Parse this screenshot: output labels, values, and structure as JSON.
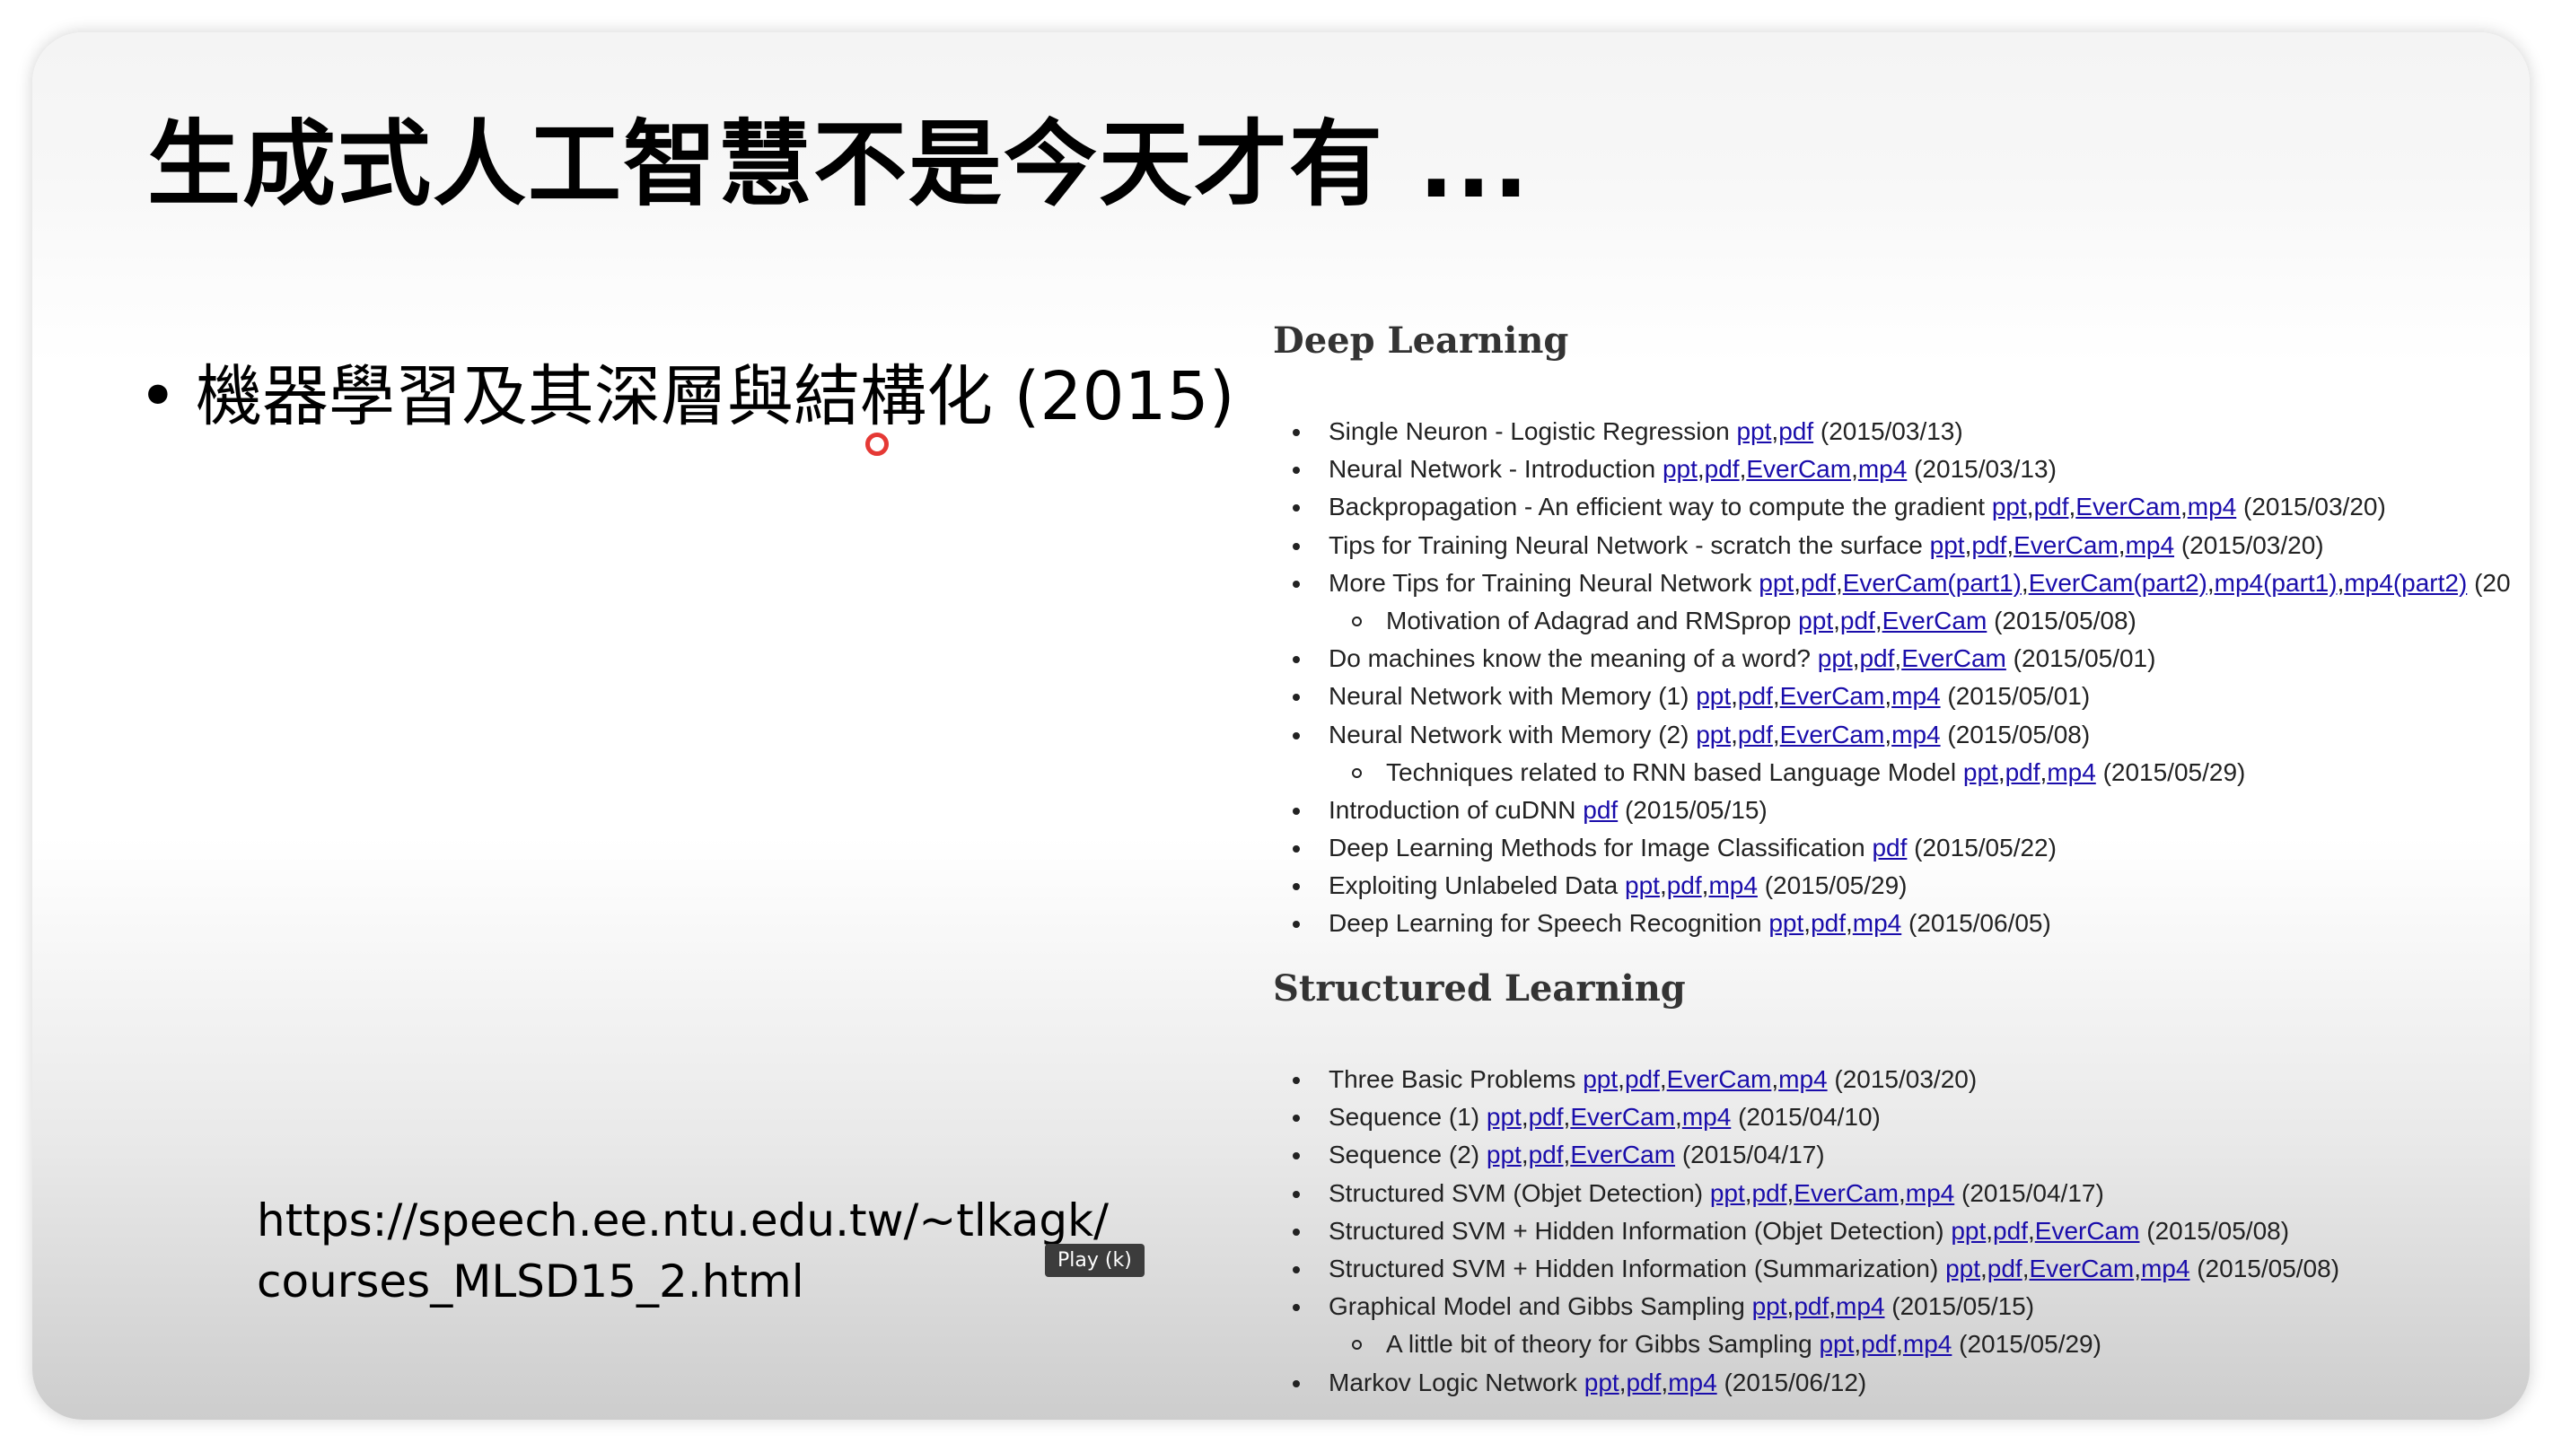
{
  "slide": {
    "title": "生成式人工智慧不是今天才有 ...",
    "bullet": "機器學習及其深層與結構化 (2015)",
    "url_line1": "https://speech.ee.ntu.edu.tw/~tlkagk/",
    "url_line2": "courses_MLSD15_2.html"
  },
  "player": {
    "tooltip": "Play (k)"
  },
  "cursor": {
    "icon": "pointer-cursor-icon",
    "color": "#e53935"
  },
  "deep_learning": {
    "heading": "Deep Learning",
    "items": [
      {
        "level": "top",
        "text": "Single Neuron - Logistic Regression",
        "links": [
          "ppt",
          "pdf"
        ],
        "date": "(2015/03/13)"
      },
      {
        "level": "top",
        "text": "Neural Network - Introduction",
        "links": [
          "ppt",
          "pdf",
          "EverCam",
          "mp4"
        ],
        "date": "(2015/03/13)"
      },
      {
        "level": "top",
        "text": "Backpropagation - An efficient way to compute the gradient",
        "links": [
          "ppt",
          "pdf",
          "EverCam",
          "mp4"
        ],
        "date": "(2015/03/20)"
      },
      {
        "level": "top",
        "text": "Tips for Training Neural Network - scratch the surface",
        "links": [
          "ppt",
          "pdf",
          "EverCam",
          "mp4"
        ],
        "date": "(2015/03/20)"
      },
      {
        "level": "top",
        "text": "More Tips for Training Neural Network",
        "links": [
          "ppt",
          "pdf",
          "EverCam(part1)",
          "EverCam(part2)",
          "mp4(part1)",
          "mp4(part2)"
        ],
        "date": "(20"
      },
      {
        "level": "sub",
        "text": "Motivation of Adagrad and RMSprop",
        "links": [
          "ppt",
          "pdf",
          "EverCam"
        ],
        "date": "(2015/05/08)"
      },
      {
        "level": "top",
        "text": "Do machines know the meaning of a word?",
        "links": [
          "ppt",
          "pdf",
          "EverCam"
        ],
        "date": "(2015/05/01)"
      },
      {
        "level": "top",
        "text": "Neural Network with Memory (1)",
        "links": [
          "ppt",
          "pdf",
          "EverCam",
          "mp4"
        ],
        "date": "(2015/05/01)"
      },
      {
        "level": "top",
        "text": "Neural Network with Memory (2)",
        "links": [
          "ppt",
          "pdf",
          "EverCam",
          "mp4"
        ],
        "date": "(2015/05/08)"
      },
      {
        "level": "sub",
        "text": "Techniques related to RNN based Language Model",
        "links": [
          "ppt",
          "pdf",
          "mp4"
        ],
        "date": "(2015/05/29)"
      },
      {
        "level": "top",
        "text": "Introduction of cuDNN",
        "links": [
          "pdf"
        ],
        "date": "(2015/05/15)"
      },
      {
        "level": "top",
        "text": "Deep Learning Methods for Image Classification",
        "links": [
          "pdf"
        ],
        "date": "(2015/05/22)"
      },
      {
        "level": "top",
        "text": "Exploiting Unlabeled Data",
        "links": [
          "ppt",
          "pdf",
          "mp4"
        ],
        "date": "(2015/05/29)"
      },
      {
        "level": "top",
        "text": "Deep Learning for Speech Recognition",
        "links": [
          "ppt",
          "pdf",
          "mp4"
        ],
        "date": "(2015/06/05)"
      }
    ]
  },
  "structured_learning": {
    "heading": "Structured Learning",
    "items": [
      {
        "level": "top",
        "text": "Three Basic Problems",
        "links": [
          "ppt",
          "pdf",
          "EverCam",
          "mp4"
        ],
        "date": "(2015/03/20)"
      },
      {
        "level": "top",
        "text": "Sequence (1)",
        "links": [
          "ppt",
          "pdf",
          "EverCam",
          "mp4"
        ],
        "date": "(2015/04/10)"
      },
      {
        "level": "top",
        "text": "Sequence (2)",
        "links": [
          "ppt",
          "pdf",
          "EverCam"
        ],
        "date": "(2015/04/17)"
      },
      {
        "level": "top",
        "text": "Structured SVM (Objet Detection)",
        "links": [
          "ppt",
          "pdf",
          "EverCam",
          "mp4"
        ],
        "date": "(2015/04/17)"
      },
      {
        "level": "top",
        "text": "Structured SVM + Hidden Information (Objet Detection)",
        "links": [
          "ppt",
          "pdf",
          "EverCam"
        ],
        "date": "(2015/05/08)"
      },
      {
        "level": "top",
        "text": "Structured SVM + Hidden Information (Summarization)",
        "links": [
          "ppt",
          "pdf",
          "EverCam",
          "mp4"
        ],
        "date": "(2015/05/08)"
      },
      {
        "level": "top",
        "text": "Graphical Model and Gibbs Sampling",
        "links": [
          "ppt",
          "pdf",
          "mp4"
        ],
        "date": "(2015/05/15)"
      },
      {
        "level": "sub",
        "text": "A little bit of theory for Gibbs Sampling",
        "links": [
          "ppt",
          "pdf",
          "mp4"
        ],
        "date": "(2015/05/29)"
      },
      {
        "level": "top",
        "text": "Markov Logic Network",
        "links": [
          "ppt",
          "pdf",
          "mp4"
        ],
        "date": "(2015/06/12)"
      }
    ]
  }
}
